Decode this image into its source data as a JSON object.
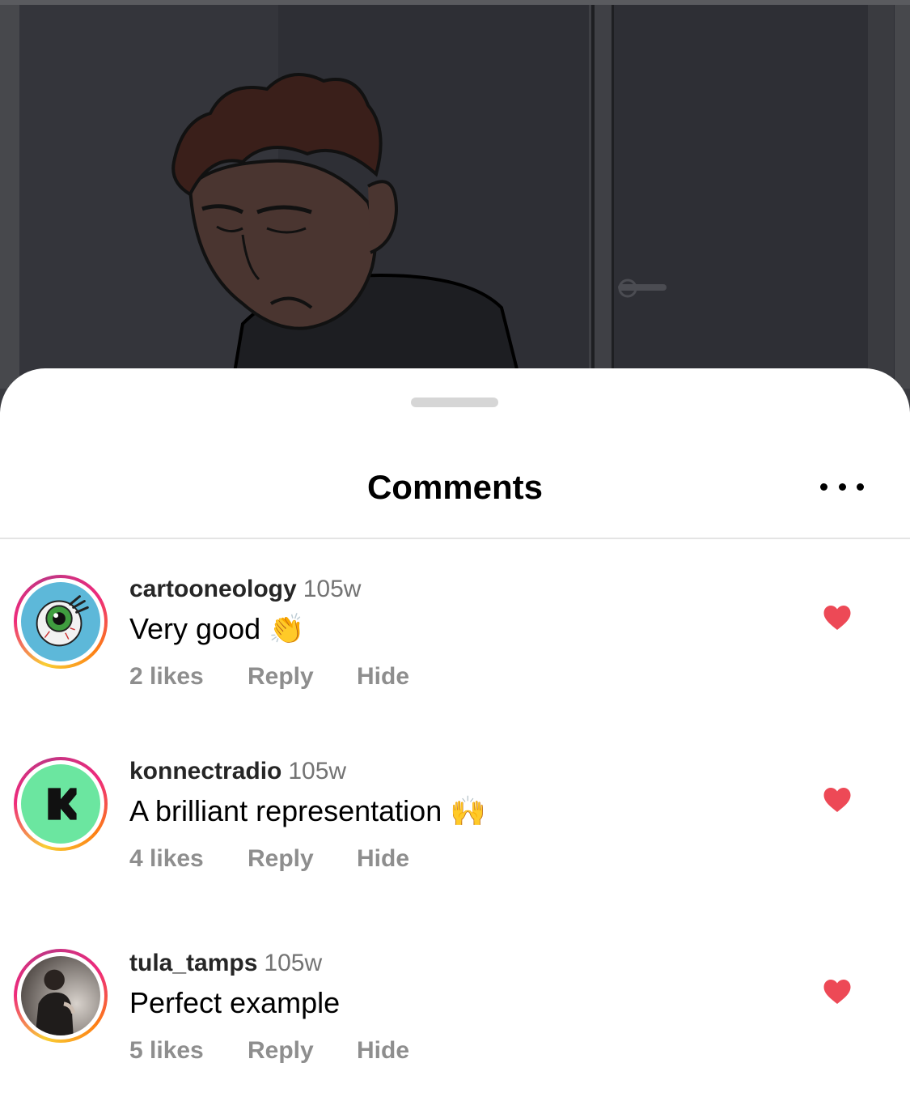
{
  "video": {
    "description_icon": "cartoon-video-frame"
  },
  "sheet": {
    "title": "Comments",
    "more_icon": "more-horizontal-icon"
  },
  "comments": [
    {
      "username": "cartooneology",
      "time": "105w",
      "text": "Very good",
      "emoji": "👏",
      "likes": "2 likes",
      "reply": "Reply",
      "hide": "Hide",
      "liked": true,
      "avatar": "eyeball-avatar"
    },
    {
      "username": "konnectradio",
      "time": "105w",
      "text": "A brilliant representation",
      "emoji": "🙌",
      "likes": "4 likes",
      "reply": "Reply",
      "hide": "Hide",
      "liked": true,
      "avatar": "k-logo-avatar"
    },
    {
      "username": "tula_tamps",
      "time": "105w",
      "text": "Perfect example",
      "emoji": "",
      "likes": "5 likes",
      "reply": "Reply",
      "hide": "Hide",
      "liked": true,
      "avatar": "person-photo-avatar"
    }
  ],
  "colors": {
    "heart": "#ed4956",
    "ring_start": "#f9ce34",
    "ring_end": "#ee2a7b",
    "meta_gray": "#8e8e8e"
  }
}
